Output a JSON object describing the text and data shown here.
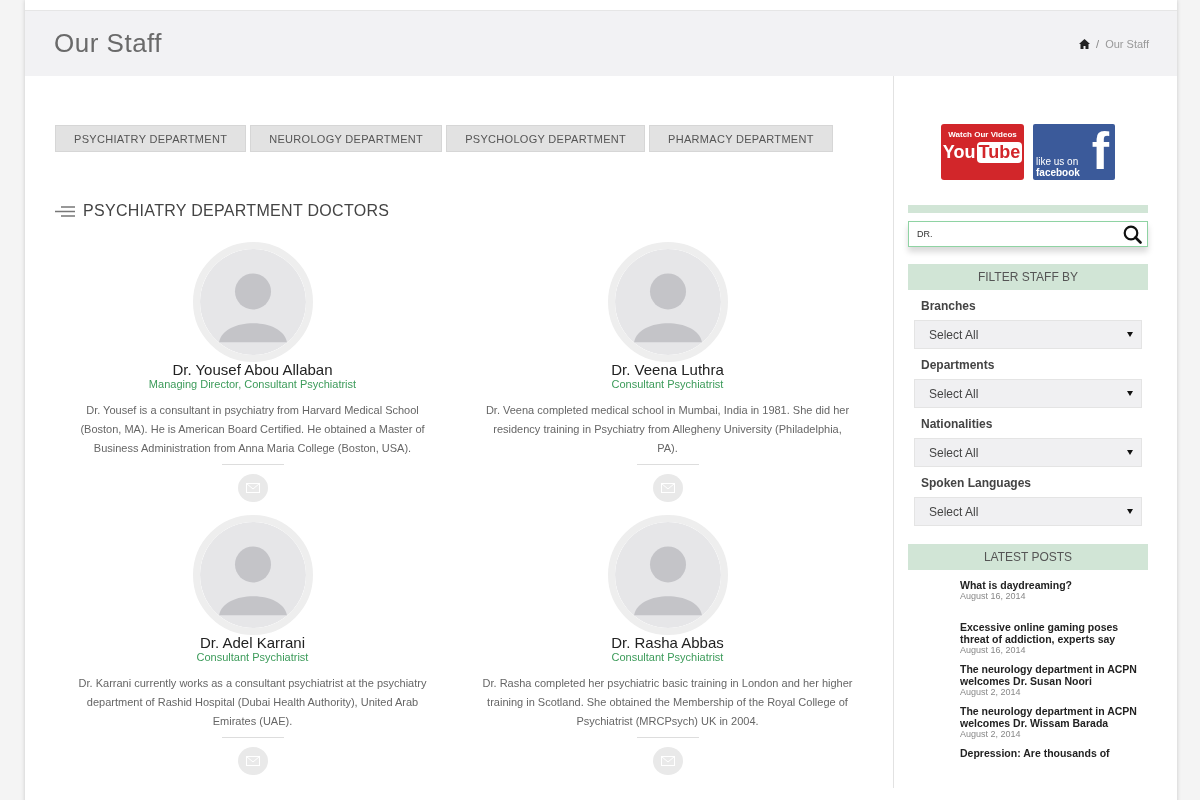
{
  "header": {
    "title": "Our Staff",
    "breadcrumb": [
      {
        "kind": "home"
      },
      {
        "kind": "text",
        "label": "Our Staff"
      }
    ],
    "separator": "/"
  },
  "tabs": [
    {
      "label": "PSYCHIATRY DEPARTMENT",
      "selected": false
    },
    {
      "label": "NEUROLOGY DEPARTMENT",
      "selected": false
    },
    {
      "label": "PSYCHOLOGY DEPARTMENT",
      "selected": false
    },
    {
      "label": "PHARMACY DEPARTMENT",
      "selected": false
    }
  ],
  "section_title": "PSYCHIATRY DEPARTMENT DOCTORS",
  "doctors": [
    {
      "name": "Dr. Yousef Abou Allaban",
      "role": "Managing Director, Consultant Psychiatrist",
      "bio": "Dr. Yousef is a consultant in psychiatry from Harvard Medical School (Boston, MA). He is American Board Certified. He obtained a Master of Business Administration from Anna Maria College (Boston, USA)."
    },
    {
      "name": "Dr. Veena Luthra",
      "role": "Consultant Psychiatrist",
      "bio": "Dr. Veena completed medical school in Mumbai, India in 1981. She did her residency training in Psychiatry from Allegheny University (Philadelphia, PA)."
    },
    {
      "name": "Dr. Adel Karrani",
      "role": "Consultant Psychiatrist",
      "bio": "Dr. Karrani currently works as a consultant psychiatrist at the psychiatry department of Rashid Hospital (Dubai Health Authority), United Arab Emirates (UAE)."
    },
    {
      "name": "Dr. Rasha Abbas",
      "role": "Consultant Psychiatrist",
      "bio": "Dr. Rasha completed her psychiatric basic training in London and her higher training in Scotland. She obtained the Membership of the Royal College of Psychiatrist (MRCPsych) UK in 2004."
    }
  ],
  "sidebar": {
    "youtube": {
      "caption": "Watch Our Videos",
      "word_1": "You",
      "word_2": "Tube"
    },
    "facebook": {
      "caption": "like us on",
      "word": "facebook",
      "letter": "f"
    },
    "search": {
      "value": "DR."
    },
    "filter_title": "FILTER STAFF BY",
    "filters": [
      {
        "label": "Branches",
        "value": "Select All"
      },
      {
        "label": "Departments",
        "value": "Select All"
      },
      {
        "label": "Nationalities",
        "value": "Select All"
      },
      {
        "label": "Spoken Languages",
        "value": "Select All"
      }
    ],
    "posts_title": "LATEST POSTS",
    "posts": [
      {
        "title": "What is daydreaming?",
        "date": "August 16, 2014"
      },
      {
        "title": "Excessive online gaming poses threat of addiction, experts say",
        "date": "August 16, 2014"
      },
      {
        "title": "The neurology department in ACPN welcomes Dr. Susan Noori",
        "date": "August 2, 2014"
      },
      {
        "title": "The neurology department in ACPN welcomes Dr. Wissam Barada",
        "date": "August 2, 2014"
      },
      {
        "title": "Depression: Are thousands of"
      }
    ]
  }
}
